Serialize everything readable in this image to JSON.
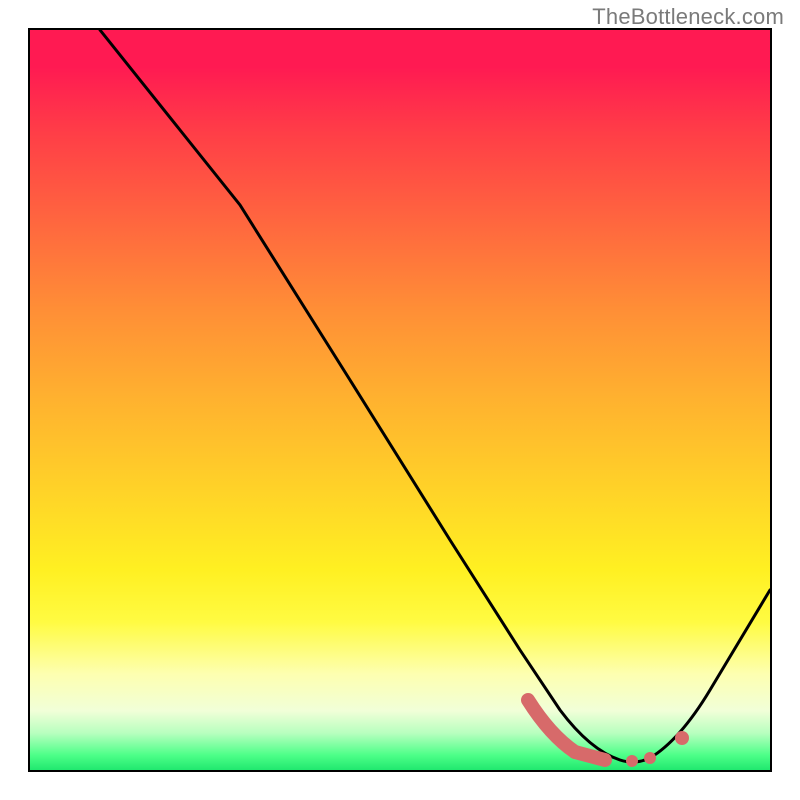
{
  "watermark": "TheBottleneck.com",
  "chart_data": {
    "type": "line",
    "title": "",
    "xlabel": "",
    "ylabel": "",
    "xlim": [
      0,
      100
    ],
    "ylim": [
      0,
      100
    ],
    "grid": false,
    "legend": false,
    "background_gradient": {
      "top_color": "#ff1a52",
      "mid_color": "#ffd228",
      "bottom_color": "#20e86f"
    },
    "series": [
      {
        "name": "main-curve",
        "color": "#000000",
        "x": [
          10,
          20,
          27,
          35,
          45,
          55,
          62,
          68,
          72,
          76,
          80,
          85,
          90,
          95,
          100
        ],
        "y": [
          100,
          87,
          78,
          68,
          54,
          40,
          30,
          21,
          14,
          8,
          4,
          1,
          3,
          10,
          20
        ]
      },
      {
        "name": "highlight-segment",
        "color": "#e06666",
        "style": "thick-dotted",
        "x": [
          68,
          71,
          74,
          77,
          80,
          83,
          85
        ],
        "y": [
          7,
          3,
          1.5,
          1.2,
          1.5,
          3,
          5
        ]
      }
    ],
    "annotations": []
  }
}
